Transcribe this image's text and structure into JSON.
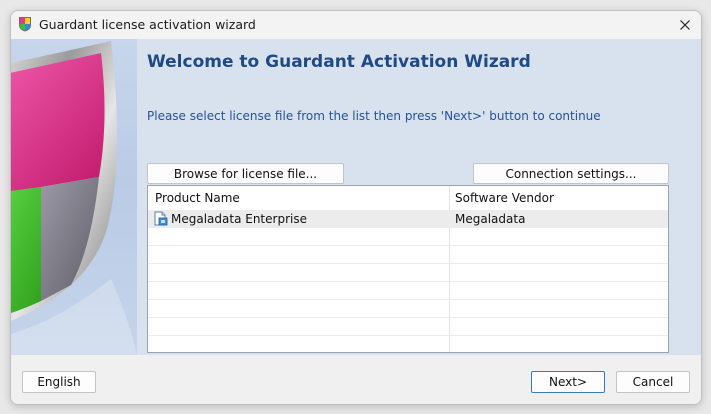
{
  "window": {
    "title": "Guardant license activation wizard"
  },
  "main": {
    "heading": "Welcome to Guardant Activation Wizard",
    "instructions": "Please select license file from the list then press 'Next>' button to continue",
    "browse_label": "Browse for license file...",
    "connection_label": "Connection settings..."
  },
  "table": {
    "columns": [
      "Product Name",
      "Software Vendor"
    ],
    "rows": [
      {
        "product": "Megaladata Enterprise",
        "vendor": "Megaladata"
      }
    ]
  },
  "footer": {
    "language_label": "English",
    "next_label": "Next>",
    "cancel_label": "Cancel"
  },
  "colors": {
    "heading": "#1f4a86",
    "instructions": "#26529a",
    "panel_bg": "#d8e1ee",
    "sidebar_bg": "#bdcde7"
  }
}
